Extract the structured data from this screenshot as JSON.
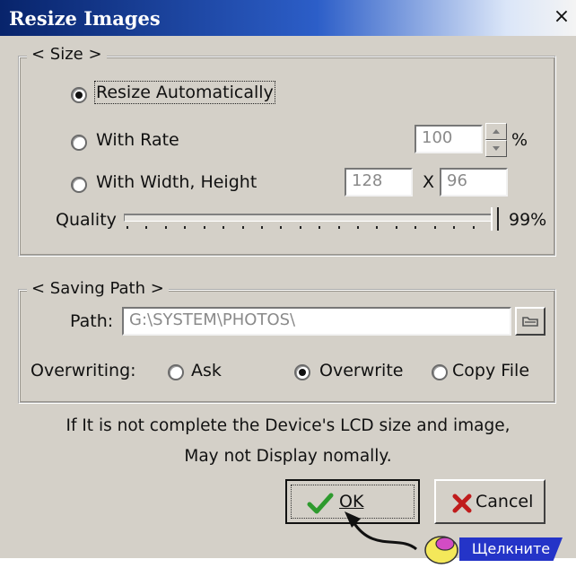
{
  "window": {
    "title": "Resize Images",
    "close_label": "×"
  },
  "size_group": {
    "legend": "< Size >",
    "options": [
      {
        "label": "Resize Automatically",
        "selected": true
      },
      {
        "label": "With Rate",
        "selected": false
      },
      {
        "label": "With Width, Height",
        "selected": false
      }
    ],
    "rate_value": "100",
    "rate_unit": "%",
    "width_value": "128",
    "separator": "X",
    "height_value": "96",
    "quality_label": "Quality",
    "quality_value": "99%",
    "quality_fraction": 0.99
  },
  "path_group": {
    "legend": "< Saving Path >",
    "path_label": "Path:",
    "path_value": "G:\\SYSTEM\\PHOTOS\\",
    "browse_icon": "folder-open-icon",
    "overwriting_label": "Overwriting:",
    "overwrite_options": [
      {
        "label": "Ask",
        "selected": false
      },
      {
        "label": "Overwrite",
        "selected": true
      },
      {
        "label": "Copy File",
        "selected": false
      }
    ]
  },
  "notice": {
    "line1": "If It is not complete the Device's LCD size and image,",
    "line2": "May not Display nomally."
  },
  "buttons": {
    "ok": "OK",
    "cancel": "Cancel"
  },
  "colors": {
    "check": "#2e9a2e",
    "cross": "#c01c1c",
    "callout_bg": "#2434c8",
    "title_bar": "#08246b"
  },
  "callout": {
    "text": "Щелкните",
    "icon": "mouse-icon"
  }
}
